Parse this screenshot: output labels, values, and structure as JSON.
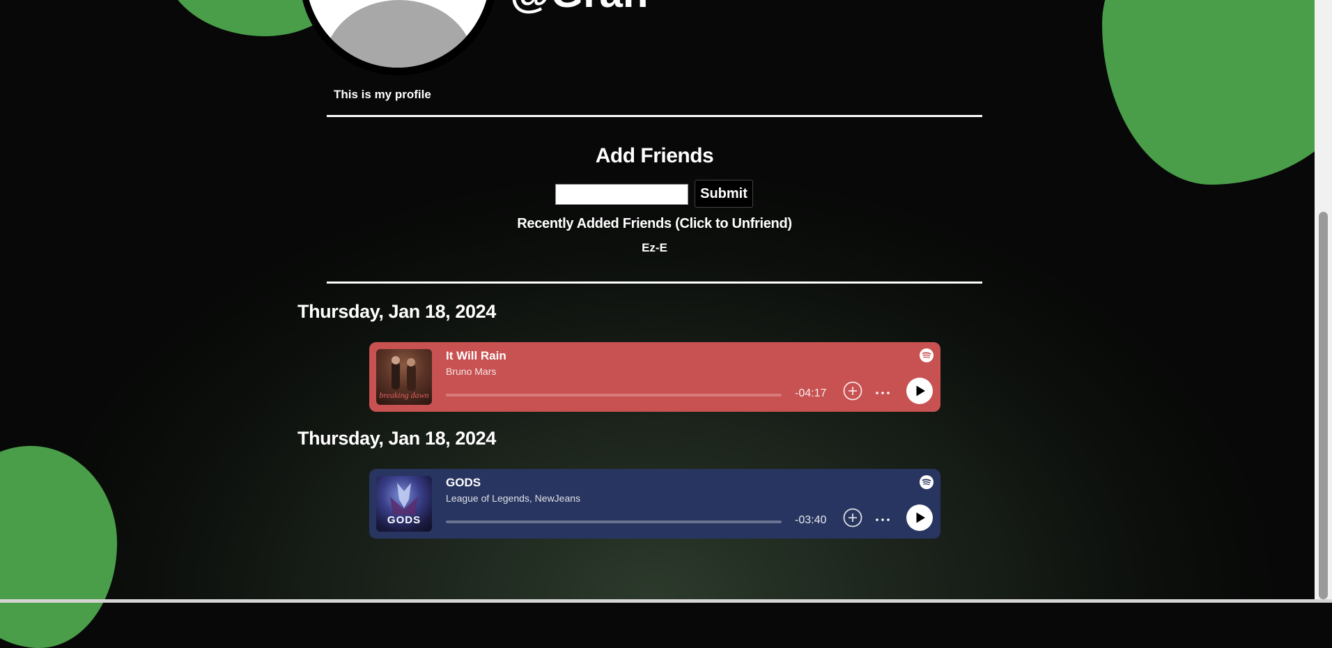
{
  "profile": {
    "username": "@Gran",
    "bio": "This is my profile"
  },
  "add_friends": {
    "title": "Add Friends",
    "input_value": "",
    "input_placeholder": "",
    "submit_label": "Submit",
    "recent_title": "Recently Added Friends (Click to Unfriend)",
    "recent_friends": [
      "Ez-E"
    ]
  },
  "feed": [
    {
      "date": "Thursday, Jan 18, 2024",
      "track": {
        "title": "It Will Rain",
        "artist": "Bruno Mars",
        "cover_text": "breaking dawn",
        "time_remaining": "-04:17",
        "progress": 0,
        "card_color": "#c85151",
        "track_color": "#d77b7b"
      }
    },
    {
      "date": "Thursday, Jan 18, 2024",
      "track": {
        "title": "GODS",
        "artist": "League of Legends, NewJeans",
        "cover_text": "GODS",
        "time_remaining": "-03:40",
        "progress": 0,
        "card_color": "#283560",
        "track_color": "#6a7390"
      }
    }
  ],
  "colors": {
    "blob": "#4a9e4a",
    "background": "#0c0f0c"
  }
}
